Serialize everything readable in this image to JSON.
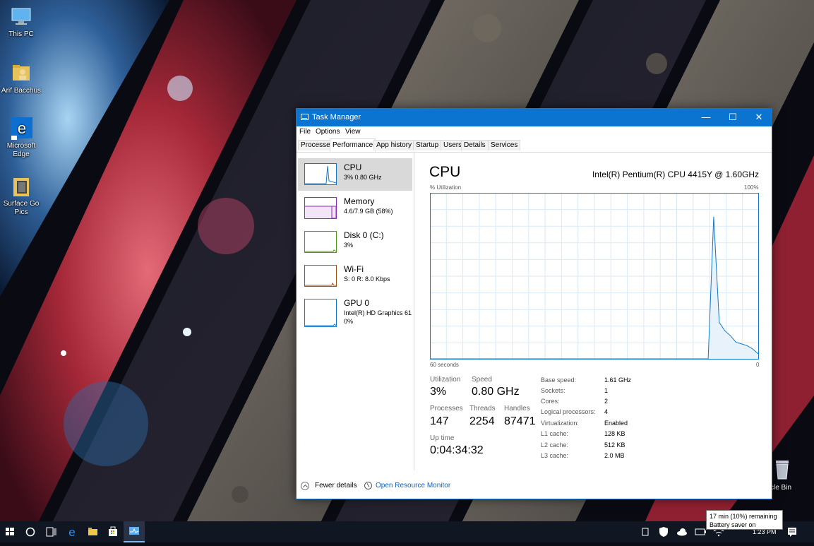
{
  "desktop": {
    "icons": [
      {
        "label": "This PC",
        "icon": "computer-icon"
      },
      {
        "label": "Arif Bacchus",
        "icon": "user-folder-icon"
      },
      {
        "label": "Microsoft Edge",
        "icon": "edge-icon"
      },
      {
        "label": "Surface Go Pics",
        "icon": "folder-icon"
      }
    ],
    "recycle_label": "cle Bin"
  },
  "window": {
    "title": "Task Manager",
    "minimize": "—",
    "maximize": "☐",
    "close": "✕",
    "menu": [
      "File",
      "Options",
      "View"
    ],
    "tabs": [
      "Processes",
      "Performance",
      "App history",
      "Startup",
      "Users",
      "Details",
      "Services"
    ],
    "active_tab": "Performance"
  },
  "resources": [
    {
      "name": "CPU",
      "sub": "3%  0.80 GHz",
      "sub2": "",
      "color": "#1179c8",
      "selected": true
    },
    {
      "name": "Memory",
      "sub": "4.6/7.9 GB (58%)",
      "sub2": "",
      "color": "#9528b4"
    },
    {
      "name": "Disk 0 (C:)",
      "sub": "3%",
      "sub2": "",
      "color": "#4c9a12"
    },
    {
      "name": "Wi-Fi",
      "sub": "S: 0  R: 8.0 Kbps",
      "sub2": "",
      "color": "#a7500e"
    },
    {
      "name": "GPU 0",
      "sub": "Intel(R) HD Graphics 61",
      "sub2": "0%",
      "color": "#1179c8"
    }
  ],
  "cpu": {
    "title": "CPU",
    "model": "Intel(R) Pentium(R) CPU 4415Y @ 1.60GHz",
    "util_label": "% Utilization",
    "max_label": "100%",
    "time_label": "60 seconds",
    "zero_label": "0",
    "utilization_label": "Utilization",
    "utilization": "3%",
    "speed_label": "Speed",
    "speed": "0.80 GHz",
    "processes_label": "Processes",
    "processes": "147",
    "threads_label": "Threads",
    "threads": "2254",
    "handles_label": "Handles",
    "handles": "87471",
    "uptime_label": "Up time",
    "uptime": "0:04:34:32",
    "details": [
      {
        "k": "Base speed:",
        "v": "1.61 GHz"
      },
      {
        "k": "Sockets:",
        "v": "1"
      },
      {
        "k": "Cores:",
        "v": "2"
      },
      {
        "k": "Logical processors:",
        "v": "4"
      },
      {
        "k": "Virtualization:",
        "v": "Enabled"
      },
      {
        "k": "L1 cache:",
        "v": "128 KB"
      },
      {
        "k": "L2 cache:",
        "v": "512 KB"
      },
      {
        "k": "L3 cache:",
        "v": "2.0 MB"
      }
    ],
    "history": [
      0,
      0,
      0,
      0,
      0,
      0,
      0,
      0,
      0,
      0,
      0,
      0,
      0,
      0,
      0,
      0,
      0,
      0,
      0,
      0,
      0,
      0,
      0,
      0,
      0,
      0,
      0,
      0,
      0,
      0,
      0,
      0,
      0,
      0,
      0,
      0,
      0,
      0,
      0,
      0,
      0,
      0,
      0,
      0,
      0,
      0,
      0,
      0,
      0,
      0,
      0,
      86,
      22,
      17,
      14,
      10,
      9,
      8,
      6,
      3
    ]
  },
  "footer": {
    "fewer": "Fewer details",
    "monitor": "Open Resource Monitor"
  },
  "taskbar": {
    "tooltip_line1": "17 min (10%) remaining",
    "tooltip_line2": "Battery saver on",
    "clock": "1:23 PM"
  },
  "colors": {
    "accent": "#0b74d0",
    "graph_line": "#1179c8",
    "graph_grid": "#d9eaf7"
  }
}
